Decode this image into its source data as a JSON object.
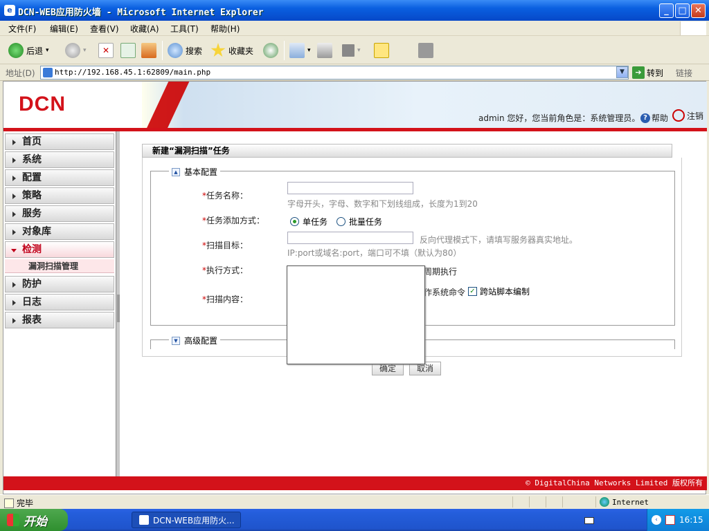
{
  "window": {
    "title": "DCN-WEB应用防火墙 - Microsoft Internet Explorer",
    "min": "_",
    "max": "□",
    "close": "✕"
  },
  "menubar": [
    "文件(F)",
    "编辑(E)",
    "查看(V)",
    "收藏(A)",
    "工具(T)",
    "帮助(H)"
  ],
  "toolbar": {
    "back": "后退",
    "search": "搜索",
    "favorites": "收藏夹"
  },
  "address": {
    "label": "地址(D)",
    "url": "http://192.168.45.1:62809/main.php",
    "go": "转到",
    "links": "链接"
  },
  "banner": {
    "logo": "DCN",
    "user_text": "admin 您好，您当前角色是：系统管理员。",
    "help": "帮助",
    "logout": "注销"
  },
  "sidebar": {
    "items": [
      "首页",
      "系统",
      "配置",
      "策略",
      "服务",
      "对象库",
      "检测",
      "防护",
      "日志",
      "报表"
    ],
    "active": "检测",
    "subitem": "漏洞扫描管理"
  },
  "panel": {
    "title": "新建“漏洞扫描”任务",
    "basic_legend": "基本配置",
    "advanced_legend": "高级配置",
    "fields": {
      "task_name_label": "任务名称：",
      "task_name_hint": "字母开头，字母、数字和下划线组成，长度为1到20",
      "add_mode_label": "任务添加方式：",
      "add_mode_single": "单任务",
      "add_mode_batch": "批量任务",
      "target_label": "扫描目标：",
      "target_hint1": "反向代理模式下，请填写服务器真实地址。",
      "target_hint2": "IP:port或域名:port，端口可不填（默认为80）",
      "exec_label": "执行方式：",
      "exec_periodic": "周期执行",
      "content_label": "扫描内容：",
      "content_cmd": "作系统命令",
      "content_xss": "跨站脚本编制"
    },
    "buttons": {
      "ok": "确定",
      "cancel": "取消"
    }
  },
  "footer": "© DigitalChina Networks Limited 版权所有",
  "status": {
    "done": "完毕",
    "zone": "Internet"
  },
  "taskbar": {
    "start": "开始",
    "task": "DCN-WEB应用防火...",
    "clock": "16:15"
  }
}
